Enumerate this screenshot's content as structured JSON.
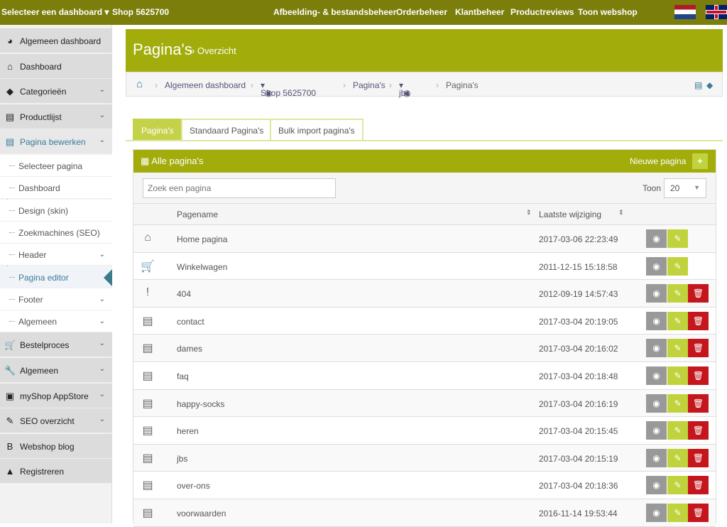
{
  "topbar": {
    "dashboard_select": "Selecteer een dashboard",
    "shop": "Shop  5625700",
    "nav": [
      "Afbeelding- & bestandsbeheer",
      "Orderbeheer",
      "Klantbeheer",
      "Productreviews",
      "Toon webshop"
    ],
    "flags": [
      "nl-flag",
      "uk-flag"
    ]
  },
  "sidebar": {
    "items": [
      {
        "label": "Algemeen dashboard",
        "icon": "dashboard-icon",
        "chev": false
      },
      {
        "label": "Dashboard",
        "icon": "home-icon",
        "chev": false
      },
      {
        "label": "Categorieën",
        "icon": "tags-icon",
        "chev": true
      },
      {
        "label": "Productlijst",
        "icon": "file-icon",
        "chev": true
      },
      {
        "label": "Pagina bewerken",
        "icon": "file-icon",
        "chev": true
      }
    ],
    "subitems": [
      {
        "label": "Selecteer pagina",
        "chev": false
      },
      {
        "label": "Dashboard",
        "chev": false
      },
      {
        "label": "Design (skin)",
        "chev": false
      },
      {
        "label": "Zoekmachines (SEO)",
        "chev": false
      },
      {
        "label": "Header",
        "chev": true
      },
      {
        "label": "Pagina editor",
        "chev": false
      },
      {
        "label": "Footer",
        "chev": true
      },
      {
        "label": "Algemeen",
        "chev": true
      }
    ],
    "items2": [
      {
        "label": "Bestelproces",
        "icon": "cart-icon",
        "chev": true
      },
      {
        "label": "Algemeen",
        "icon": "wrench-icon",
        "chev": true
      },
      {
        "label": "myShop AppStore",
        "icon": "play-icon",
        "chev": true
      },
      {
        "label": "SEO overzicht",
        "icon": "edit-icon",
        "chev": true
      },
      {
        "label": "Webshop blog",
        "icon": "blog-icon",
        "chev": false
      },
      {
        "label": "Registreren",
        "icon": "warning-icon",
        "chev": false
      }
    ]
  },
  "header": {
    "title": "Pagina's",
    "subtitle": "Overzicht"
  },
  "breadcrumb": [
    "Algemeen dashboard",
    "Shop 5625700",
    "Pagina's",
    "jbs",
    "Pagina's"
  ],
  "tabs": [
    "Pagina's",
    "Standaard Pagina's",
    "Bulk import pagina's"
  ],
  "panel": {
    "title": "Alle pagina's",
    "new_label": "Nieuwe pagina",
    "search_placeholder": "Zoek een pagina",
    "show_label": "Toon",
    "show_value": "20",
    "col_name": "Pagename",
    "col_date": "Laatste wijziging"
  },
  "colors": {
    "topbar": "#7b7e0b",
    "accent": "#a2ad0b",
    "edit": "#c1d33c",
    "delete": "#c4161c",
    "view": "#999999"
  },
  "rows": [
    {
      "icon": "home-icon",
      "name": "Home pagina",
      "date": "2017-03-06 22:23:49",
      "del": false
    },
    {
      "icon": "cart-icon",
      "name": "Winkelwagen",
      "date": "2011-12-15 15:18:58",
      "del": false
    },
    {
      "icon": "exclamation-icon",
      "name": "404",
      "date": "2012-09-19 14:57:43",
      "del": true
    },
    {
      "icon": "file-icon",
      "name": "contact",
      "date": "2017-03-04 20:19:05",
      "del": true
    },
    {
      "icon": "file-icon",
      "name": "dames",
      "date": "2017-03-04 20:16:02",
      "del": true
    },
    {
      "icon": "file-icon",
      "name": "faq",
      "date": "2017-03-04 20:18:48",
      "del": true
    },
    {
      "icon": "file-icon",
      "name": "happy-socks",
      "date": "2017-03-04 20:16:19",
      "del": true
    },
    {
      "icon": "file-icon",
      "name": "heren",
      "date": "2017-03-04 20:15:45",
      "del": true
    },
    {
      "icon": "file-icon",
      "name": "jbs",
      "date": "2017-03-04 20:15:19",
      "del": true
    },
    {
      "icon": "file-icon",
      "name": "over-ons",
      "date": "2017-03-04 20:18:36",
      "del": true
    },
    {
      "icon": "file-icon",
      "name": "voorwaarden",
      "date": "2016-11-14 19:53:44",
      "del": true
    }
  ]
}
